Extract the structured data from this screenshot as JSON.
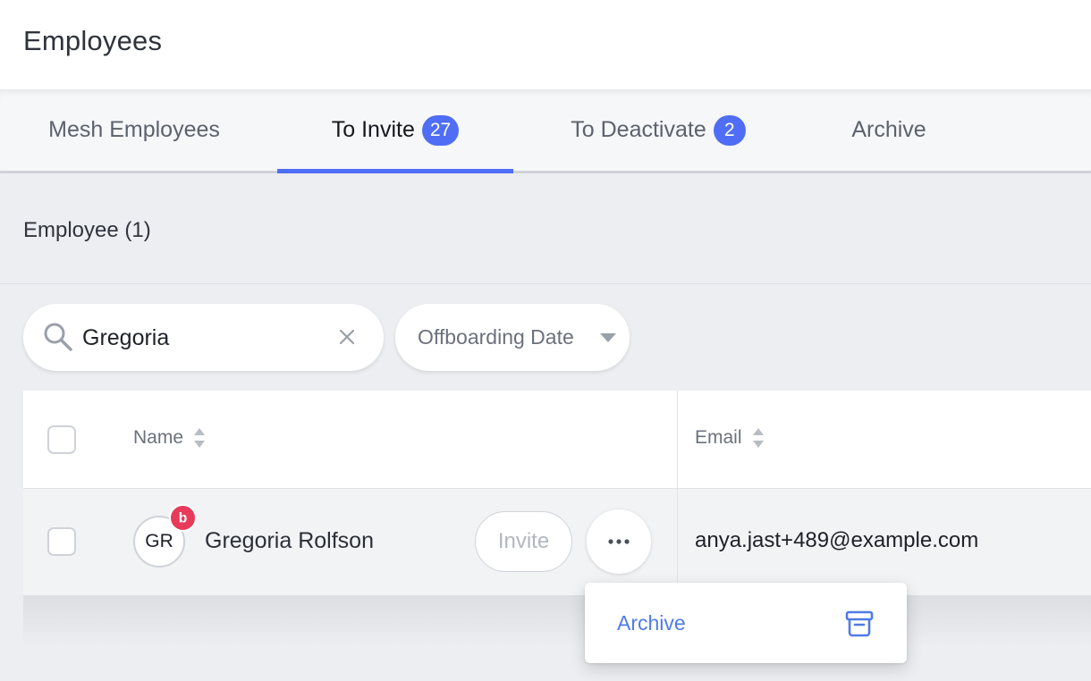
{
  "header": {
    "title": "Employees"
  },
  "tabs": [
    {
      "label": "Mesh Employees",
      "badge": null,
      "active": false
    },
    {
      "label": "To Invite",
      "badge": "27",
      "active": true
    },
    {
      "label": "To Deactivate",
      "badge": "2",
      "active": false
    },
    {
      "label": "Archive",
      "badge": null,
      "active": false
    }
  ],
  "section": {
    "title": "Employee (1)"
  },
  "search": {
    "value": "Gregoria",
    "clear_icon": "close-icon",
    "icon": "search-icon"
  },
  "filter": {
    "label": "Offboarding Date",
    "icon": "chevron-down-icon"
  },
  "table": {
    "columns": [
      {
        "label": "Name",
        "sortable": true
      },
      {
        "label": "Email",
        "sortable": true
      }
    ],
    "rows": [
      {
        "initials": "GR",
        "badge_color": "#e83a5a",
        "name": "Gregoria Rolfson",
        "email": "anya.jast+489@example.com",
        "action_label": "Invite"
      }
    ]
  },
  "row_menu": {
    "items": [
      {
        "label": "Archive",
        "icon": "archive-icon"
      }
    ]
  },
  "colors": {
    "accent": "#4f6ef5",
    "link": "#4f7be6",
    "badge_red": "#e83a5a"
  }
}
